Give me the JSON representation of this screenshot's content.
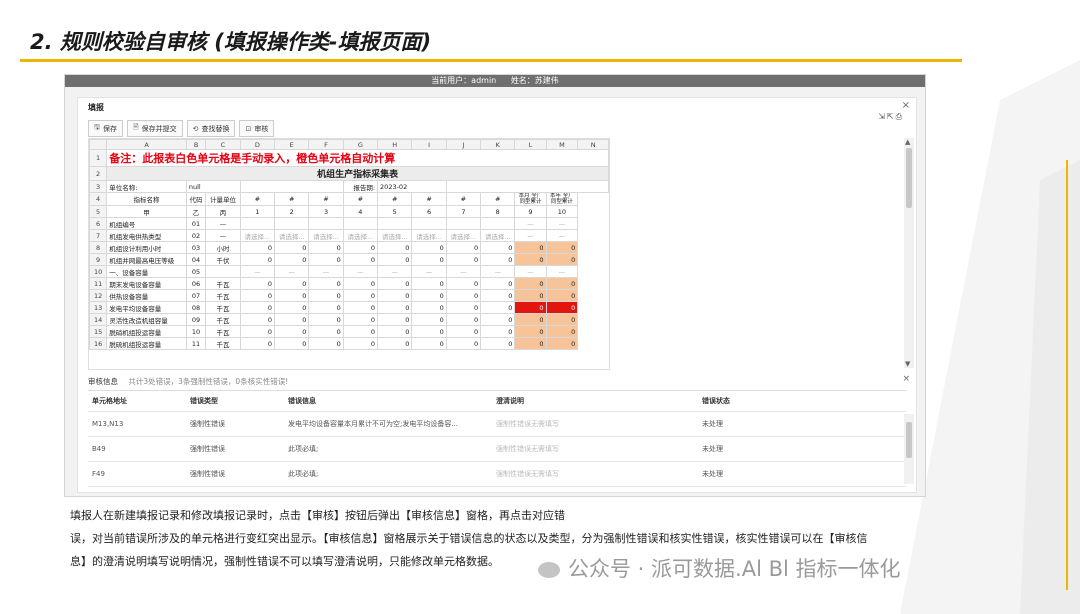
{
  "slide": {
    "title": "2. 规则校验自审核 (填报操作类-填报页面)"
  },
  "userbar": {
    "user": "当前用户：admin",
    "name": "姓名：苏建伟"
  },
  "panel": {
    "title": "填报"
  },
  "toolbar": {
    "save": "保存",
    "save_submit": "保存并提交",
    "find_replace": "查找替换",
    "review": "审核"
  },
  "sheet": {
    "columns": [
      "A",
      "B",
      "C",
      "D",
      "E",
      "F",
      "G",
      "H",
      "I",
      "J",
      "K",
      "L",
      "M",
      "N"
    ],
    "note": "备注：此报表白色单元格是手动录入，橙色单元格自动计算",
    "table_title": "机组生产指标采集表",
    "unit_label": "单位名称:",
    "unit_value": "null",
    "period_label": "报告期:",
    "period_value": "2023-02",
    "hdr_name": "指标名称",
    "hdr_code": "代码",
    "hdr_unit": "计量单位",
    "hash": "#",
    "month_total": "本月 全厂 同型累计",
    "year_total": "本年 全厂 同型累计",
    "r5": [
      "甲",
      "乙",
      "丙",
      "1",
      "2",
      "3",
      "4",
      "5",
      "6",
      "7",
      "8",
      "9",
      "10"
    ],
    "placeholder": "请选择...",
    "dash": "—",
    "zero": "0",
    "rows": [
      {
        "n": "6",
        "name": "机组编号",
        "code": "01",
        "unit": "—"
      },
      {
        "n": "7",
        "name": "机组发电供热类型",
        "code": "02",
        "unit": "—"
      },
      {
        "n": "8",
        "name": "机组设计利用小时",
        "code": "03",
        "unit": "小时"
      },
      {
        "n": "9",
        "name": "机组并网最高电压等级",
        "code": "04",
        "unit": "千伏"
      },
      {
        "n": "10",
        "name": "一、设备容量",
        "code": "05",
        "unit": ""
      },
      {
        "n": "11",
        "name": "期末发电设备容量",
        "code": "06",
        "unit": "千瓦"
      },
      {
        "n": "12",
        "name": "供热设备容量",
        "code": "07",
        "unit": "千瓦"
      },
      {
        "n": "13",
        "name": "发电平均设备容量",
        "code": "08",
        "unit": "千瓦"
      },
      {
        "n": "14",
        "name": "灵活性改造机组容量",
        "code": "09",
        "unit": "千瓦"
      },
      {
        "n": "15",
        "name": "脱硝机组投运容量",
        "code": "10",
        "unit": "千瓦"
      },
      {
        "n": "16",
        "name": "脱硫机组投运容量",
        "code": "11",
        "unit": "千瓦"
      }
    ]
  },
  "review": {
    "label": "审核信息",
    "summary": "共计3处错误，3条强制性错误，0条核实性错误!",
    "headers": [
      "单元格地址",
      "错误类型",
      "错误信息",
      "澄清说明",
      "错误状态"
    ],
    "rows": [
      {
        "addr": "M13,N13",
        "type": "强制性错误",
        "msg": "发电平均设备容量本月累计不可为空;发电平均设备容...",
        "note": "强制性错误无需填写",
        "status": "未处理"
      },
      {
        "addr": "B49",
        "type": "强制性错误",
        "msg": "此项必填;",
        "note": "强制性错误无需填写",
        "status": "未处理"
      },
      {
        "addr": "F49",
        "type": "强制性错误",
        "msg": "此项必填;",
        "note": "强制性错误无需填写",
        "status": "未处理"
      }
    ]
  },
  "description": {
    "line1": "填报人在新建填报记录和修改填报记录时，点击【审核】按钮后弹出【审核信息】窗格，再点击对应错",
    "line2": "误，对当前错误所涉及的单元格进行变红突出显示。【审核信息】窗格展示关于错误信息的状态以及类型，分为强制性错误和核实性错误，核实性错误可以在【审核信",
    "line3": "息】的澄清说明填写说明情况，强制性错误不可以填写澄清说明，只能修改单元格数据。"
  },
  "watermark": "公众号 · 派可数据.Al Bl 指标一体化",
  "colors": {
    "accent": "#f0b400",
    "note_red": "#e60012",
    "error_cell": "#e3150f",
    "auto_cell": "#f7c49a"
  }
}
